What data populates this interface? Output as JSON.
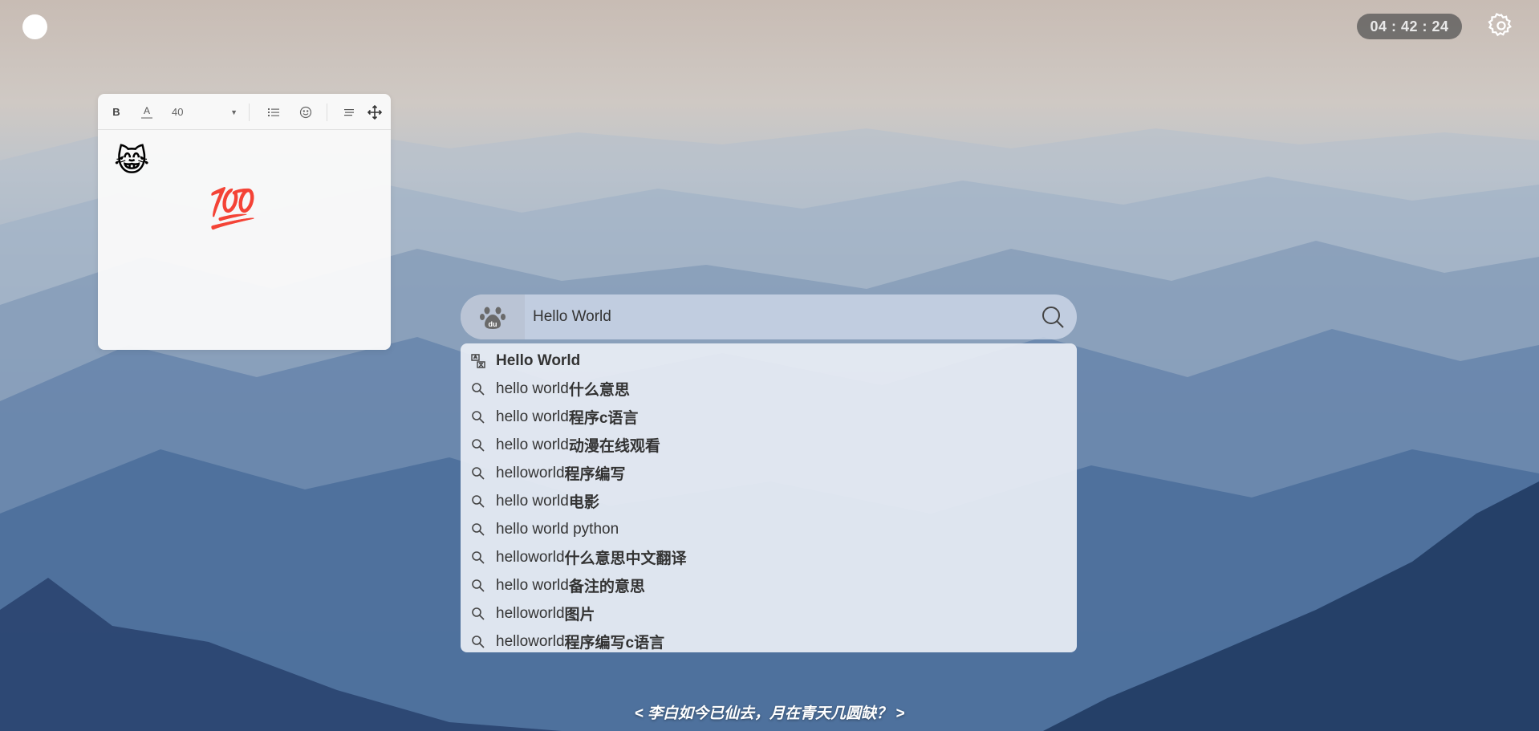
{
  "clock": "04 : 42 : 24",
  "note": {
    "toolbar": {
      "bold_label": "B",
      "color_label": "A",
      "font_size": "40"
    },
    "emojis": [
      "😹",
      "💯"
    ]
  },
  "search": {
    "engine": "du",
    "value": "Hello World"
  },
  "suggestions": [
    {
      "prefix": "Hello World",
      "suffix": "",
      "icon": "translate-icon"
    },
    {
      "prefix": "hello world",
      "suffix": "什么意思",
      "icon": "search-icon"
    },
    {
      "prefix": "hello world",
      "suffix": "程序c语言",
      "icon": "search-icon"
    },
    {
      "prefix": "hello world",
      "suffix": "动漫在线观看",
      "icon": "search-icon"
    },
    {
      "prefix": "helloworld",
      "suffix": "程序编写",
      "icon": "search-icon"
    },
    {
      "prefix": "hello world",
      "suffix": "电影",
      "icon": "search-icon"
    },
    {
      "prefix": "hello world python",
      "suffix": "",
      "icon": "search-icon"
    },
    {
      "prefix": "helloworld",
      "suffix": "什么意思中文翻译",
      "icon": "search-icon"
    },
    {
      "prefix": "hello world",
      "suffix": "备注的意思",
      "icon": "search-icon"
    },
    {
      "prefix": "helloworld",
      "suffix": "图片",
      "icon": "search-icon"
    },
    {
      "prefix": "helloworld",
      "suffix": "程序编写c语言",
      "icon": "search-icon"
    }
  ],
  "quote": "< 李白如今已仙去，月在青天几圆缺？ >"
}
